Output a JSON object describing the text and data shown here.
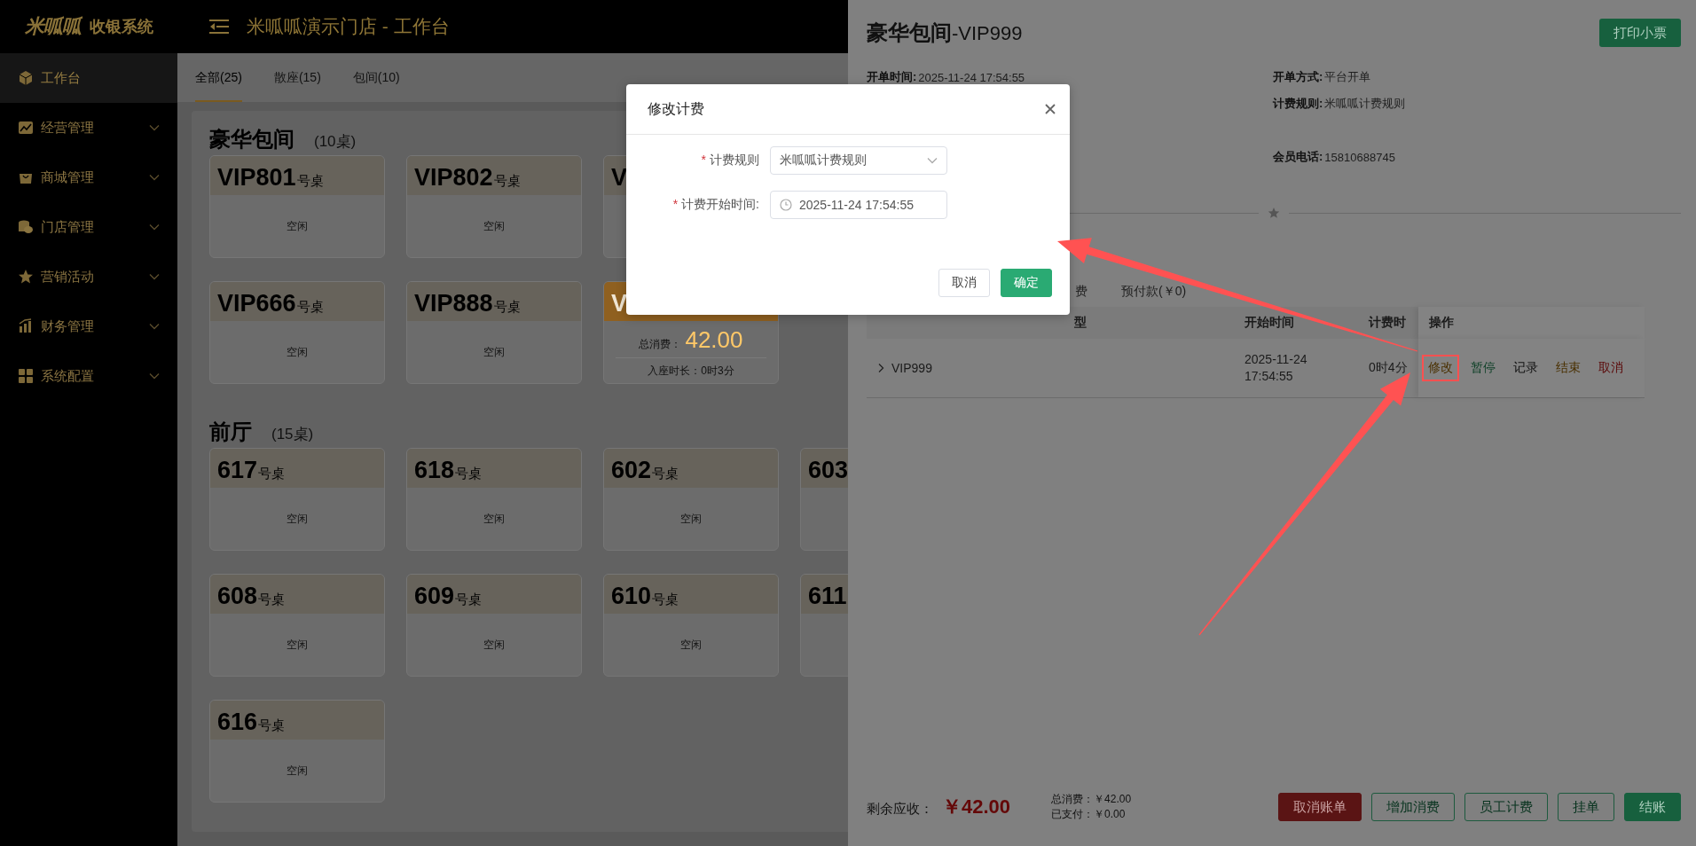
{
  "header": {
    "logo": "米呱呱",
    "app_name": "收银系统",
    "title": "米呱呱演示门店 - 工作台"
  },
  "sidebar": {
    "items": [
      {
        "label": "工作台",
        "selected": true,
        "expandable": false
      },
      {
        "label": "经营管理",
        "selected": false,
        "expandable": true
      },
      {
        "label": "商城管理",
        "selected": false,
        "expandable": true
      },
      {
        "label": "门店管理",
        "selected": false,
        "expandable": true
      },
      {
        "label": "营销活动",
        "selected": false,
        "expandable": true
      },
      {
        "label": "财务管理",
        "selected": false,
        "expandable": true
      },
      {
        "label": "系统配置",
        "selected": false,
        "expandable": true
      }
    ]
  },
  "tabs": [
    {
      "label": "全部(25)",
      "selected": true
    },
    {
      "label": "散座(15)",
      "selected": false
    },
    {
      "label": "包间(10)",
      "selected": false
    }
  ],
  "sections": [
    {
      "title": "豪华包间",
      "count": "(10桌)",
      "rows": [
        [
          {
            "kind": "idle",
            "number": "VIP801",
            "suffix": "号桌",
            "status": "空闲"
          },
          {
            "kind": "idle",
            "number": "VIP802",
            "suffix": "号桌",
            "status": "空闲"
          },
          {
            "kind": "idle",
            "number": "V"
          }
        ],
        [
          {
            "kind": "idle",
            "number": "VIP666",
            "suffix": "号桌",
            "status": "空闲"
          },
          {
            "kind": "idle",
            "number": "VIP888",
            "suffix": "号桌",
            "status": "空闲"
          },
          {
            "kind": "occupied",
            "number": "V",
            "total_label": "总消费：",
            "total": "42.00",
            "duration": "入座时长：0时3分"
          }
        ]
      ]
    },
    {
      "title": "前厅",
      "count": "(15桌)",
      "rows": [
        [
          {
            "kind": "idle",
            "number": "617",
            "suffix": "号桌",
            "status": "空闲"
          },
          {
            "kind": "idle",
            "number": "618",
            "suffix": "号桌",
            "status": "空闲"
          },
          {
            "kind": "idle",
            "number": "602",
            "suffix": "号桌",
            "status": "空闲"
          },
          {
            "kind": "idle",
            "number": "603"
          }
        ],
        [
          {
            "kind": "idle",
            "number": "608",
            "suffix": "号桌",
            "status": "空闲"
          },
          {
            "kind": "idle",
            "number": "609",
            "suffix": "号桌",
            "status": "空闲"
          },
          {
            "kind": "idle",
            "number": "610",
            "suffix": "号桌",
            "status": "空闲"
          },
          {
            "kind": "idle",
            "number": "611"
          }
        ],
        [
          {
            "kind": "idle",
            "number": "616",
            "suffix": "号桌",
            "status": "空闲"
          }
        ]
      ]
    }
  ],
  "drawer": {
    "title": "**豪华包间**-VIP999",
    "print_button": "打印小票",
    "info": [
      {
        "label": "开单时间:",
        "value": "2025-11-24 17:54:55"
      },
      {
        "label": "开单方式:",
        "value": "平台开单"
      },
      {
        "label": "计费规则:",
        "value": "米呱呱计费规则"
      },
      {
        "label": "会员电话:",
        "value": "15810688745"
      }
    ],
    "tabs": [
      {
        "label": "费",
        "selected": false
      },
      {
        "label": "预付款(￥0)",
        "selected": false
      }
    ],
    "table": {
      "columns": [
        "型",
        "开始时间",
        "计费时",
        "操作"
      ],
      "rows": [
        {
          "name": "VIP999",
          "start": "2025-11-24 17:54:55",
          "duration": "0时4分",
          "actions": [
            {
              "label": "修改",
              "kind": "edit",
              "highlighted": true
            },
            {
              "label": "暂停",
              "kind": "pause",
              "highlighted": false
            },
            {
              "label": "记录",
              "kind": "log",
              "highlighted": false
            },
            {
              "label": "结束",
              "kind": "end",
              "highlighted": false
            },
            {
              "label": "取消",
              "kind": "cancel",
              "highlighted": false
            }
          ]
        }
      ]
    },
    "footer": {
      "due_label": "剩余应收：",
      "due": "￥42.00",
      "total": "总消费：￥42.00",
      "paid": "已支付：￥0.00",
      "buttons": [
        {
          "label": "取消账单",
          "kind": "danger"
        },
        {
          "label": "增加消费",
          "kind": "outline"
        },
        {
          "label": "员工计费",
          "kind": "outline"
        },
        {
          "label": "挂单",
          "kind": "outline"
        },
        {
          "label": "结账",
          "kind": "primary"
        }
      ]
    }
  },
  "modal": {
    "title": "修改计费",
    "fields": [
      {
        "kind": "select",
        "required_mark": "*",
        "label": "计费规则",
        "value": "米呱呱计费规则"
      },
      {
        "kind": "datetime",
        "required_mark": "*",
        "label": "计费开始时间:",
        "value": "2025-11-24 17:54:55"
      }
    ],
    "buttons": [
      {
        "label": "取消",
        "kind": "default"
      },
      {
        "label": "确定",
        "kind": "primary"
      }
    ]
  }
}
